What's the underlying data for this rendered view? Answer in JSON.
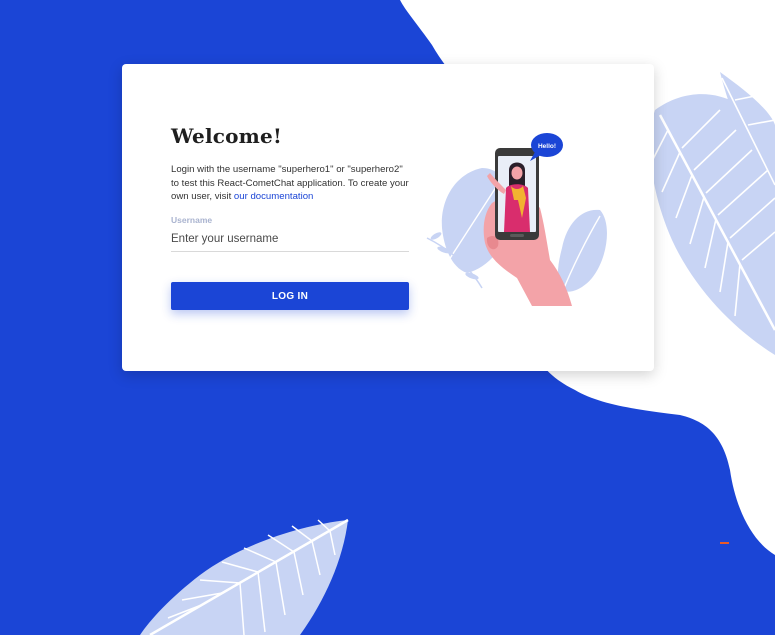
{
  "welcome": {
    "title": "Welcome!",
    "intro_text": "Login with the username \"superhero1\" or \"superhero2\" to test this React-CometChat application. To create your own user, visit ",
    "doc_link": "our documentation"
  },
  "form": {
    "username_label": "Username",
    "username_placeholder": "Enter your username",
    "username_value": "",
    "login_label": "LOG IN"
  },
  "illustration": {
    "bubble_text": "Hello!"
  },
  "colors": {
    "brand": "#1b45d6",
    "leaf": "#c8d4f4",
    "accent": "#e85a2a"
  }
}
